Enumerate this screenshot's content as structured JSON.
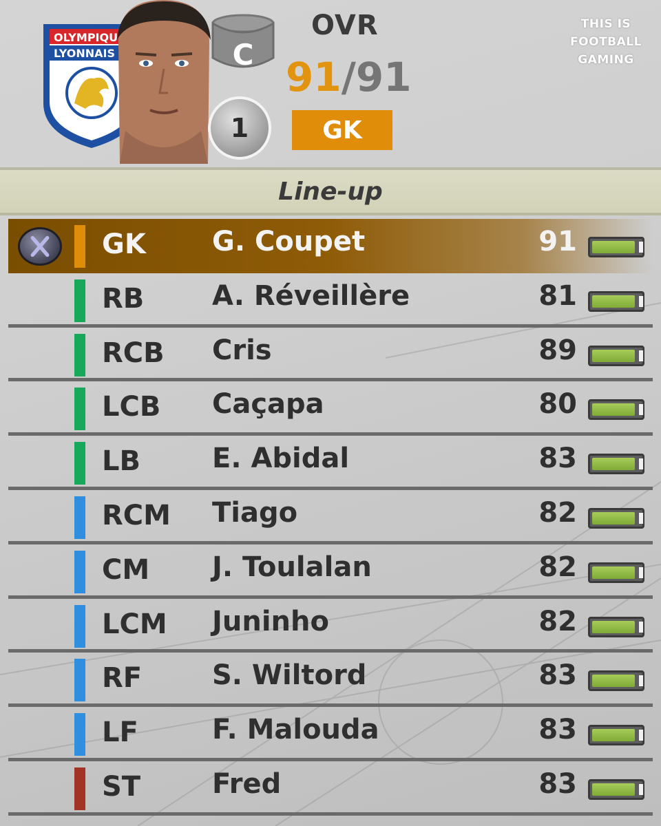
{
  "header": {
    "club_logo": {
      "name": "Olympique Lyonnais",
      "text_line1": "OLYMPIQUE",
      "text_line2": "LYONNAIS"
    },
    "player_face": "player-portrait",
    "cup_icon": "captain-cup-icon",
    "squad_number": "1",
    "ovr_label": "OVR",
    "ovr_current": "91",
    "ovr_separator": "/",
    "ovr_max": "91",
    "position": "GK"
  },
  "watermark": {
    "line1": "THIS IS",
    "line2": "FOOTBALL",
    "line3": "GAMING"
  },
  "section": {
    "title": "Line-up"
  },
  "button_icon": "x-button-icon",
  "colors": {
    "gk": "#e08d0a",
    "defender": "#17a85a",
    "midfielder": "#2e8ee0",
    "forward": "#2e8ee0",
    "striker": "#a33324",
    "selected_row": "#8a5806",
    "stamina": "#8cb83f"
  },
  "lineup": [
    {
      "pos": "GK",
      "name": "G. Coupet",
      "rating": "91",
      "group": "gk",
      "stamina": 1.0
    },
    {
      "pos": "RB",
      "name": "A. Réveillère",
      "rating": "81",
      "group": "defender",
      "stamina": 1.0
    },
    {
      "pos": "RCB",
      "name": "Cris",
      "rating": "89",
      "group": "defender",
      "stamina": 1.0
    },
    {
      "pos": "LCB",
      "name": "Caçapa",
      "rating": "80",
      "group": "defender",
      "stamina": 1.0
    },
    {
      "pos": "LB",
      "name": "E. Abidal",
      "rating": "83",
      "group": "defender",
      "stamina": 1.0
    },
    {
      "pos": "RCM",
      "name": "Tiago",
      "rating": "82",
      "group": "midfielder",
      "stamina": 1.0
    },
    {
      "pos": "CM",
      "name": "J. Toulalan",
      "rating": "82",
      "group": "midfielder",
      "stamina": 1.0
    },
    {
      "pos": "LCM",
      "name": "Juninho",
      "rating": "82",
      "group": "midfielder",
      "stamina": 1.0
    },
    {
      "pos": "RF",
      "name": "S. Wiltord",
      "rating": "83",
      "group": "forward",
      "stamina": 1.0
    },
    {
      "pos": "LF",
      "name": "F. Malouda",
      "rating": "83",
      "group": "forward",
      "stamina": 1.0
    },
    {
      "pos": "ST",
      "name": "Fred",
      "rating": "83",
      "group": "striker",
      "stamina": 1.0
    }
  ],
  "selected_index": 0
}
